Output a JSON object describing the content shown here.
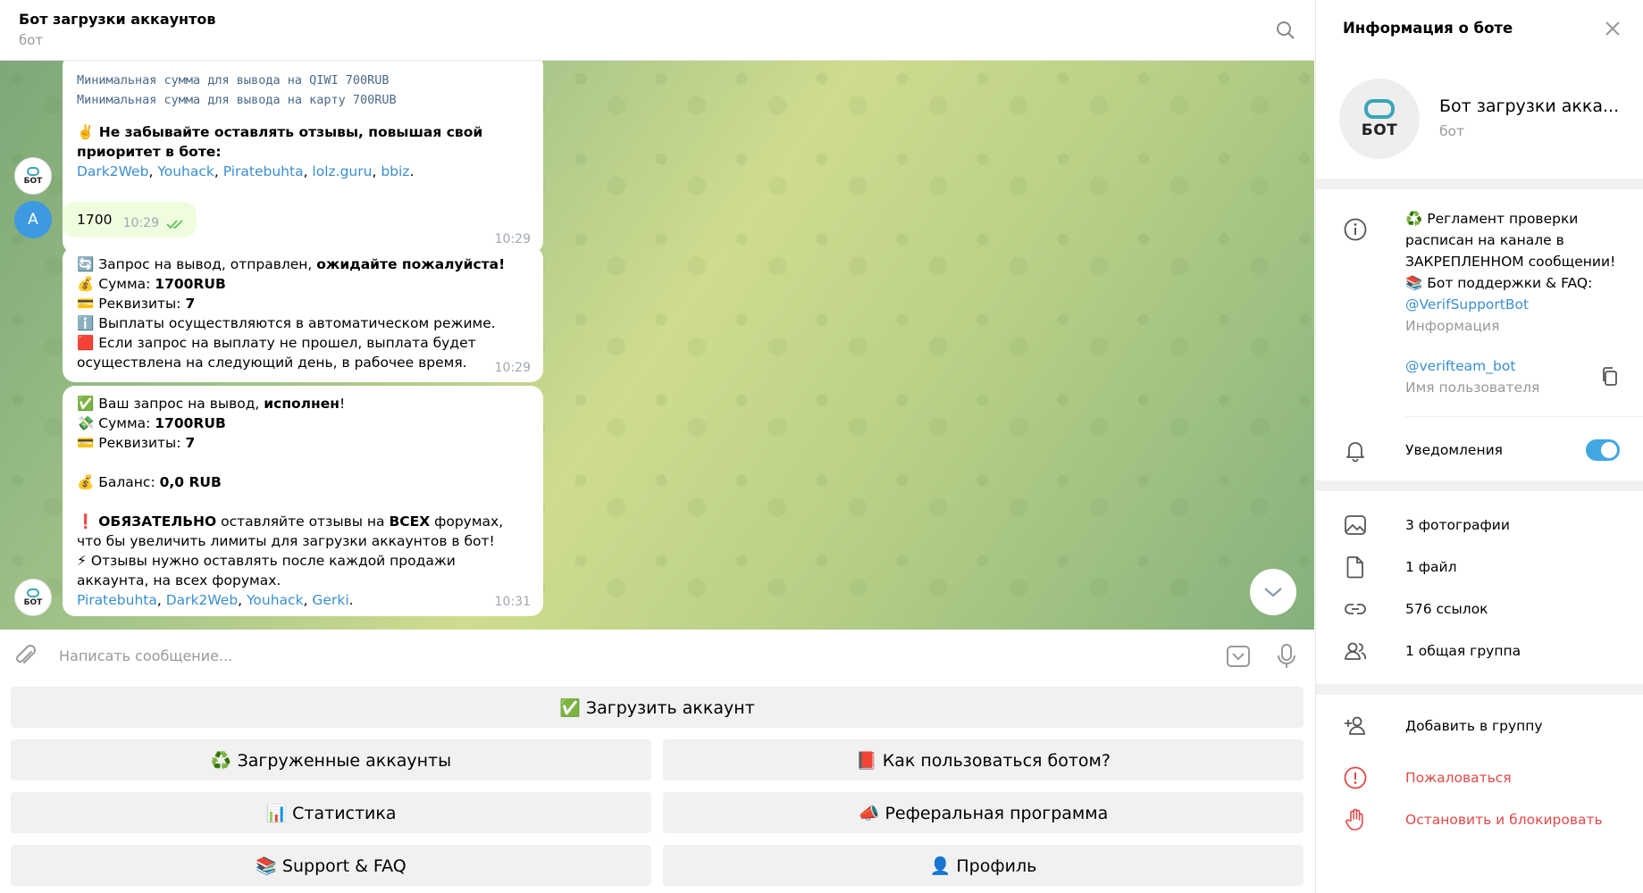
{
  "header": {
    "title": "Бот загрузки аккаунтов",
    "subtitle": "бот"
  },
  "messages": {
    "m1": {
      "mono1": "Минимальная сумма для вывода на QIWI 700RUB",
      "mono2": "Минимальная сумма для вывода на карту 700RUB",
      "emoji": "✌️",
      "bold": "Не забывайте оставлять отзывы, повышая свой приоритет в боте:",
      "links": [
        "Dark2Web",
        "Youhack",
        "Piratebuhta",
        "lolz.guru",
        "bbiz"
      ],
      "time": "10:29"
    },
    "m2": {
      "text": "1700",
      "time": "10:29",
      "avatar": "A"
    },
    "m3": {
      "l1_emoji": "🔄",
      "l1_a": "Запрос на вывод,  отправлен, ",
      "l1_b": "ожидайте пожалуйста!",
      "l2_emoji": "💰",
      "l2_a": "Сумма: ",
      "l2_b": "1700RUB",
      "l3_emoji": "💳",
      "l3_a": "Реквизиты: ",
      "l3_b": "7",
      "l4_emoji": "ℹ️",
      "l4": "Выплаты осуществляются в автоматическом режиме.",
      "l5_emoji": "🟥",
      "l5": "Если запрос на выплату не прошел, выплата будет осуществлена на следующий день, в рабочее время.",
      "time": "10:29"
    },
    "m4": {
      "l1_emoji": "✅",
      "l1_a": "Ваш запрос на вывод, ",
      "l1_b": "исполнен",
      "l1_c": "!",
      "l2_emoji": "💸",
      "l2_a": "Сумма: ",
      "l2_b": "1700RUB",
      "l3_emoji": "💳",
      "l3_a": "Реквизиты: ",
      "l3_b": "7",
      "l4_emoji": "💰",
      "l4_a": "Баланс: ",
      "l4_b": "0,0 RUB",
      "l5_emoji": "❗",
      "l5_b": "ОБЯЗАТЕЛЬНО",
      "l5_a": " оставляйте отзывы на ",
      "l5_c": "ВСЕХ",
      "l5_d": " форумах, что бы увеличить лимиты для загрузки аккаунтов в бот!",
      "l6_emoji": "⚡",
      "l6": "Отзывы нужно оставлять после каждой продажи аккаунта, на всех форумах.",
      "links": [
        "Piratebuhta",
        "Dark2Web",
        "Youhack",
        "Gerki"
      ],
      "time": "10:31"
    }
  },
  "input": {
    "placeholder": "Написать сообщение..."
  },
  "keyboard": {
    "b1": "✅ Загрузить аккаунт",
    "b2": "♻️ Загруженные аккаунты",
    "b3": "📕 Как пользоваться ботом?",
    "b4": "📊 Статистика",
    "b5": "📣 Реферальная программа",
    "b6": "📚 Support & FAQ",
    "b7": "👤 Профиль"
  },
  "panel": {
    "title": "Информация о боте",
    "name": "Бот загрузки акка...",
    "name_sub": "бот",
    "avatar_text": "БОТ",
    "info_1": "♻️ Регламент проверки",
    "info_2": "расписан на канале в",
    "info_3": "ЗАКРЕПЛЕННОМ сообщении!",
    "info_4": "📚 Бот поддержки & FAQ:",
    "info_link": "@VerifSupportBot",
    "info_label": "Информация",
    "username": "@verifteam_bot",
    "username_label": "Имя пользователя",
    "notifications": "Уведомления",
    "photos": "3 фотографии",
    "files": "1 файл",
    "links": "576 ссылок",
    "groups": "1 общая группа",
    "add_group": "Добавить в группу",
    "report": "Пожаловаться",
    "block": "Остановить и блокировать"
  },
  "colors": {
    "accent": "#40a7e3",
    "danger": "#e14a4a",
    "link": "#3a8fd0"
  }
}
